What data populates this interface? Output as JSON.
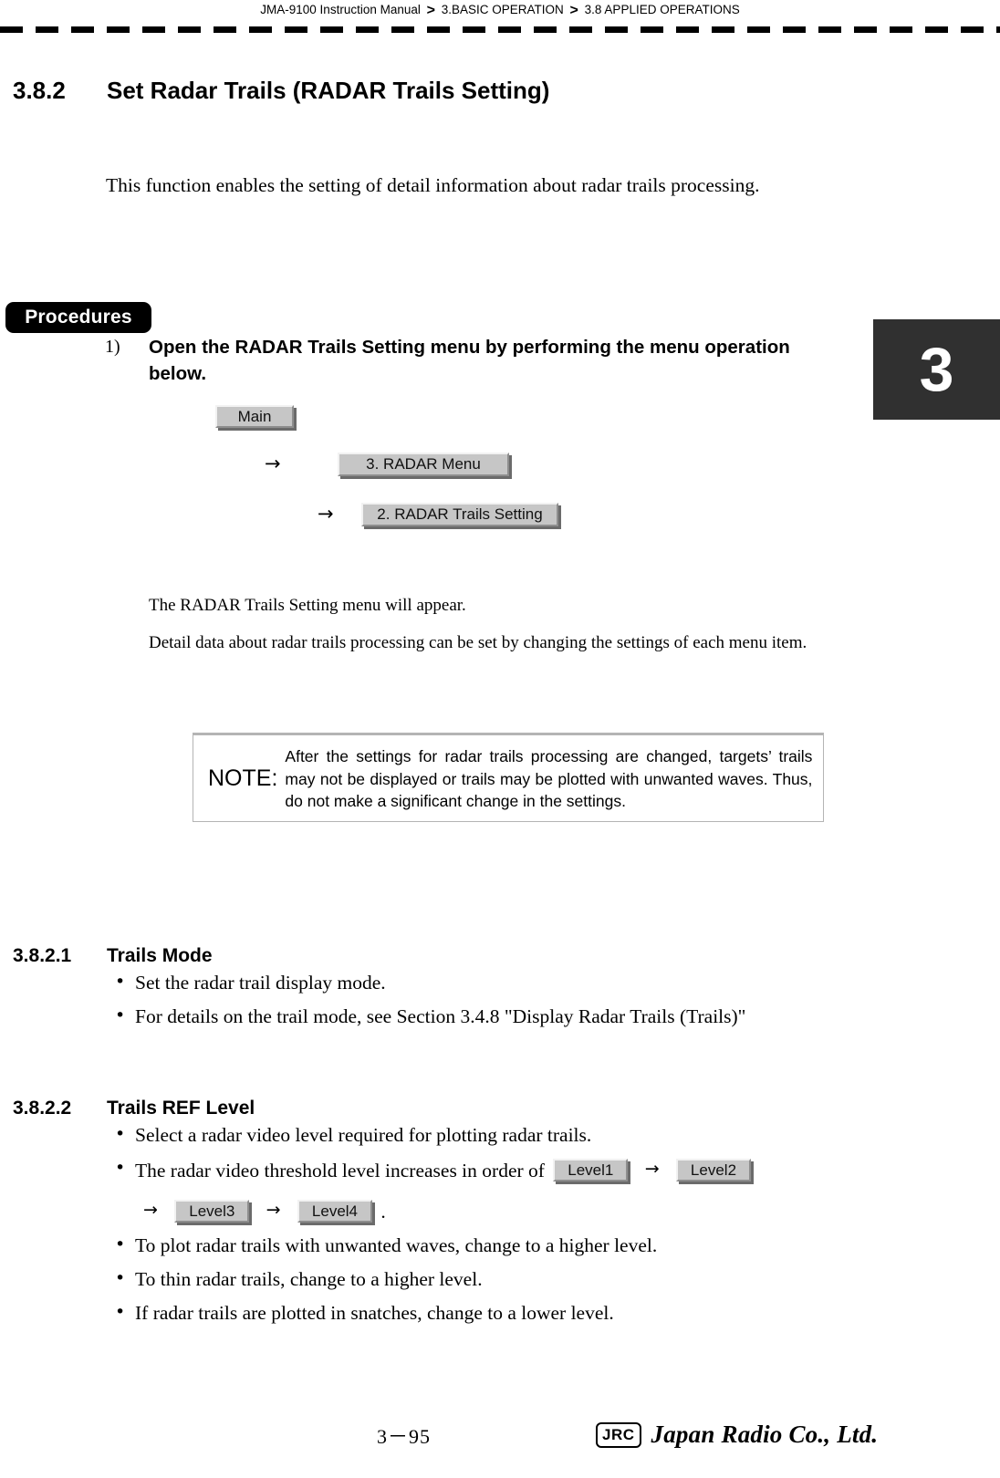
{
  "header": {
    "manual": "JMA-9100 Instruction Manual",
    "separator": ">",
    "crumb_chapter": "3.BASIC OPERATION",
    "crumb_section": "3.8  APPLIED OPERATIONS"
  },
  "chapter_tab": {
    "label": "3"
  },
  "section": {
    "number": "3.8.2",
    "title": "Set Radar Trails (RADAR Trails Setting)",
    "intro": "This function enables the setting of detail information about radar trails processing."
  },
  "procedures": {
    "badge_label": "Procedures",
    "step1_number": "1)",
    "step1_text": "Open the RADAR Trails Setting menu by performing the menu operation below.",
    "menu_chain": {
      "btn_main": "Main",
      "arrow_1": "→",
      "btn_radar_menu": "3. RADAR Menu",
      "arrow_2": "→",
      "btn_trails_setting": "2. RADAR Trails Setting"
    },
    "appear_line": "The RADAR Trails Setting menu will appear.",
    "detail_line": "Detail data about radar trails processing can be set by changing the settings of each menu item."
  },
  "note": {
    "label": "NOTE:",
    "text": "After the settings for radar trails processing are changed, targets’ trails may not be displayed or trails may be plotted with unwanted waves. Thus, do not make a significant change in the settings."
  },
  "subsections": [
    {
      "number": "3.8.2.1",
      "title": "Trails Mode",
      "bullets": [
        "Set the radar trail display mode.",
        "For details on the trail mode, see Section 3.4.8 \"Display Radar Trails (Trails)\""
      ]
    },
    {
      "number": "3.8.2.2",
      "title": "Trails REF Level",
      "bullets": [
        "Select a radar video level required for plotting radar trails.",
        "To plot radar trails with unwanted waves, change to a higher level.",
        "To thin radar trails, change to a higher level.",
        "If radar trails are plotted in snatches, change to a lower level."
      ],
      "threshold_bullet": {
        "lead": "The radar video threshold level increases in order of",
        "level1": "Level1",
        "arrow_a": "→",
        "level2": "Level2",
        "arrow_b": "→",
        "level3": "Level3",
        "arrow_c": "→",
        "level4": "Level4",
        "period": "."
      }
    }
  ],
  "footer": {
    "page_number": "3－95",
    "brand_mark": "JRC",
    "brand_name": "Japan Radio Co., Ltd."
  },
  "colors": {
    "chapter_tab_bg": "#303030",
    "badge_bg": "#000000",
    "button_face": "#c6c6c6",
    "button_highlight": "#f2f2f2",
    "button_shadow": "#8e8e8e",
    "note_border": "#b4b4b4"
  }
}
